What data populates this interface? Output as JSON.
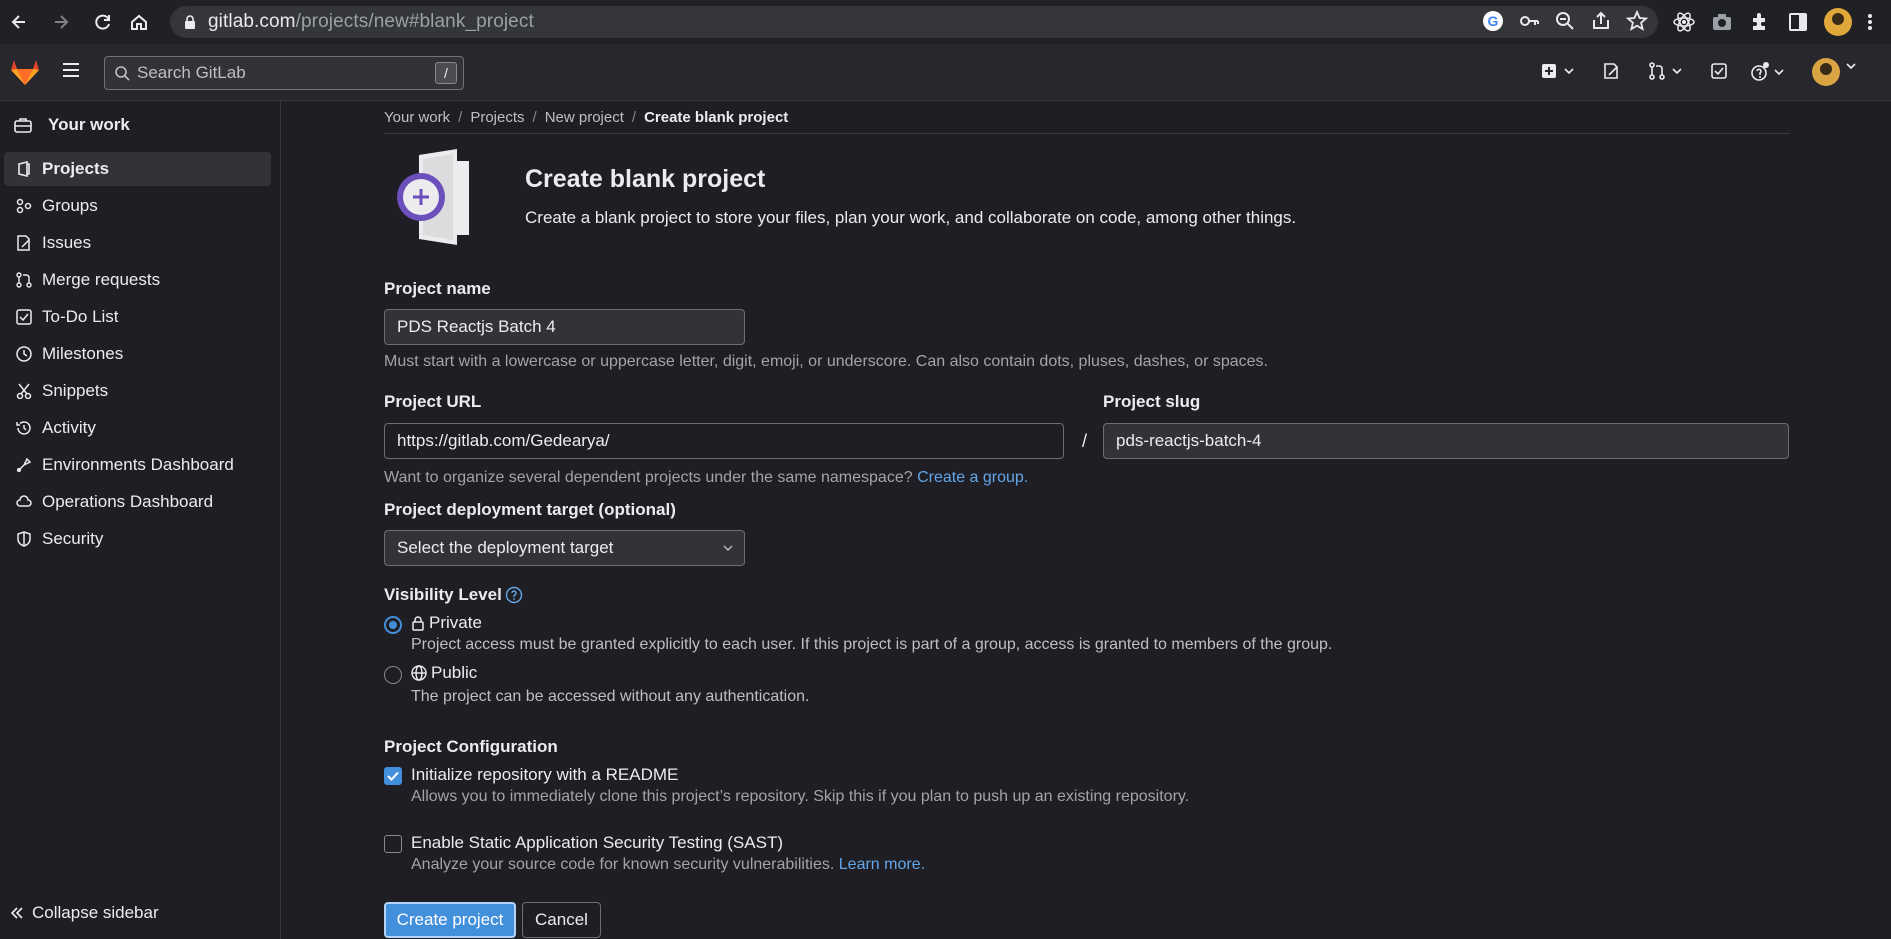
{
  "browser": {
    "url_host": "gitlab.com",
    "url_path": "/projects/new#blank_project"
  },
  "header": {
    "search_placeholder": "Search GitLab",
    "search_shortcut": "/"
  },
  "sidebar": {
    "context_label": "Your work",
    "items": [
      {
        "label": "Projects",
        "icon": "project-icon",
        "active": true
      },
      {
        "label": "Groups",
        "icon": "group-icon",
        "active": false
      },
      {
        "label": "Issues",
        "icon": "issues-icon",
        "active": false
      },
      {
        "label": "Merge requests",
        "icon": "merge-request-icon",
        "active": false
      },
      {
        "label": "To-Do List",
        "icon": "todo-icon",
        "active": false
      },
      {
        "label": "Milestones",
        "icon": "clock-icon",
        "active": false
      },
      {
        "label": "Snippets",
        "icon": "snippet-icon",
        "active": false
      },
      {
        "label": "Activity",
        "icon": "history-icon",
        "active": false
      },
      {
        "label": "Environments Dashboard",
        "icon": "environment-icon",
        "active": false
      },
      {
        "label": "Operations Dashboard",
        "icon": "cloud-gear-icon",
        "active": false
      },
      {
        "label": "Security",
        "icon": "shield-icon",
        "active": false
      }
    ],
    "collapse_label": "Collapse sidebar"
  },
  "breadcrumb": [
    "Your work",
    "Projects",
    "New project",
    "Create blank project"
  ],
  "hero": {
    "title": "Create blank project",
    "description": "Create a blank project to store your files, plan your work, and collaborate on code, among other things."
  },
  "form": {
    "project_name": {
      "label": "Project name",
      "value": "PDS Reactjs Batch 4",
      "help": "Must start with a lowercase or uppercase letter, digit, emoji, or underscore. Can also contain dots, pluses, dashes, or spaces."
    },
    "project_url": {
      "label": "Project URL",
      "value": "https://gitlab.com/Gedearya/",
      "separator": "/",
      "help": "Want to organize several dependent projects under the same namespace?",
      "help_link": "Create a group."
    },
    "project_slug": {
      "label": "Project slug",
      "value": "pds-reactjs-batch-4"
    },
    "deployment_target": {
      "label": "Project deployment target (optional)",
      "selected": "Select the deployment target"
    },
    "visibility": {
      "label": "Visibility Level",
      "options": [
        {
          "label": "Private",
          "icon": "lock-icon",
          "checked": true,
          "help": "Project access must be granted explicitly to each user. If this project is part of a group, access is granted to members of the group."
        },
        {
          "label": "Public",
          "icon": "earth-icon",
          "checked": false,
          "help": "The project can be accessed without any authentication."
        }
      ]
    },
    "configuration": {
      "label": "Project Configuration",
      "options": [
        {
          "label": "Initialize repository with a README",
          "checked": true,
          "help": "Allows you to immediately clone this project’s repository. Skip this if you plan to push up an existing repository."
        },
        {
          "label": "Enable Static Application Security Testing (SAST)",
          "checked": false,
          "help": "Analyze your source code for known security vulnerabilities.",
          "help_link": "Learn more."
        }
      ]
    },
    "create_button": "Create project",
    "cancel_button": "Cancel"
  },
  "colors": {
    "accent": "#428fdc",
    "link": "#63a6e9",
    "background": "#1f1e24",
    "header": "#28272d"
  }
}
